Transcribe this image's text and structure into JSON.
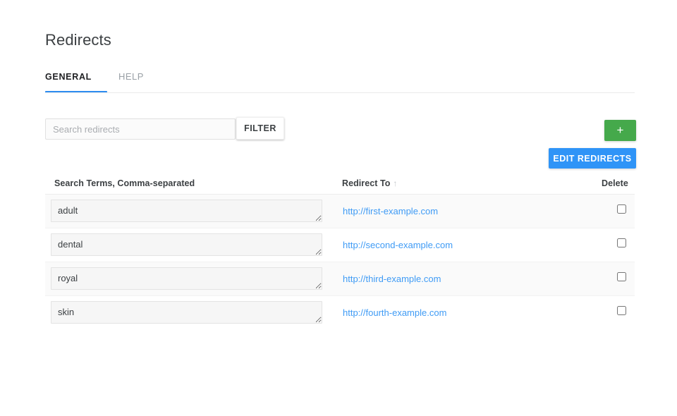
{
  "page": {
    "title": "Redirects"
  },
  "tabs": [
    {
      "id": "general",
      "label": "GENERAL",
      "active": true
    },
    {
      "id": "help",
      "label": "HELP",
      "active": false
    }
  ],
  "toolbar": {
    "search_placeholder": "Search redirects",
    "search_value": "",
    "filter_label": "FILTER",
    "add_label": "+",
    "edit_label": "EDIT REDIRECTS",
    "add_color": "#45a94b",
    "edit_color": "#2f94f7"
  },
  "table": {
    "columns": {
      "terms": "Search Terms, Comma-separated",
      "redirect": "Redirect To",
      "sort_arrow": "↑",
      "delete": "Delete"
    },
    "rows": [
      {
        "terms": "adult",
        "redirect": "http://first-example.com",
        "delete_checked": false
      },
      {
        "terms": "dental",
        "redirect": "http://second-example.com",
        "delete_checked": false
      },
      {
        "terms": "royal",
        "redirect": "http://third-example.com",
        "delete_checked": false
      },
      {
        "terms": "skin",
        "redirect": "http://fourth-example.com",
        "delete_checked": false
      }
    ]
  }
}
